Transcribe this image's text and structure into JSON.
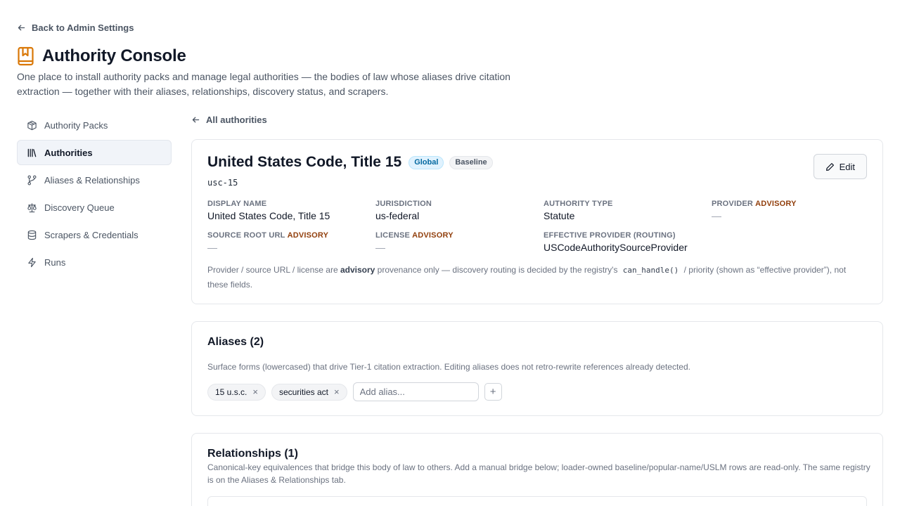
{
  "back_label": "Back to Admin Settings",
  "header": {
    "title": "Authority Console",
    "description": "One place to install authority packs and manage legal authorities — the bodies of law whose aliases drive citation extraction — together with their aliases, relationships, discovery status, and scrapers."
  },
  "sidebar": {
    "items": [
      {
        "label": "Authority Packs",
        "icon": "package-icon"
      },
      {
        "label": "Authorities",
        "icon": "library-icon"
      },
      {
        "label": "Aliases & Relationships",
        "icon": "branch-icon"
      },
      {
        "label": "Discovery Queue",
        "icon": "scale-icon"
      },
      {
        "label": "Scrapers & Credentials",
        "icon": "database-icon"
      },
      {
        "label": "Runs",
        "icon": "lightning-icon"
      }
    ],
    "active": "Authorities"
  },
  "main": {
    "all_link": "All authorities",
    "authority": {
      "title": "United States Code, Title 15",
      "badges": [
        "Global",
        "Baseline"
      ],
      "key": "usc-15",
      "edit_label": "Edit",
      "advisory_tag": "ADVISORY",
      "fields": {
        "display_name": {
          "label": "Display name",
          "value": "United States Code, Title 15"
        },
        "jurisdiction": {
          "label": "Jurisdiction",
          "value": "us-federal"
        },
        "authority_type": {
          "label": "Authority type",
          "value": "Statute"
        },
        "provider": {
          "label": "Provider",
          "value": "—"
        },
        "source_root_url": {
          "label": "Source root URL",
          "value": "—"
        },
        "license": {
          "label": "License",
          "value": "—"
        },
        "effective_provider": {
          "label": "Effective provider (routing)",
          "value": "USCodeAuthoritySourceProvider"
        }
      },
      "note": {
        "prefix": "Provider / source URL / license are ",
        "bold": "advisory",
        "middle": " provenance only — discovery routing is decided by the registry's ",
        "code": "can_handle()",
        "suffix": " / priority (shown as “effective provider”), not these fields."
      }
    },
    "aliases": {
      "title": "Aliases (2)",
      "description": "Surface forms (lowercased) that drive Tier-1 citation extraction. Editing aliases does not retro-rewrite references already detected.",
      "items": [
        "15 u.s.c.",
        "securities act"
      ],
      "input_placeholder": "Add alias...",
      "add_label": "+"
    },
    "relationships": {
      "title": "Relationships (1)",
      "description": "Canonical-key equivalences that bridge this body of law to others. Add a manual bridge below; loader-owned baseline/popular-name/USLM rows are read-only. The same registry is on the Aliases & Relationships tab."
    }
  },
  "colors": {
    "accent": "#d97706",
    "advisory": "#92400e",
    "global_badge": "#0369a1"
  }
}
